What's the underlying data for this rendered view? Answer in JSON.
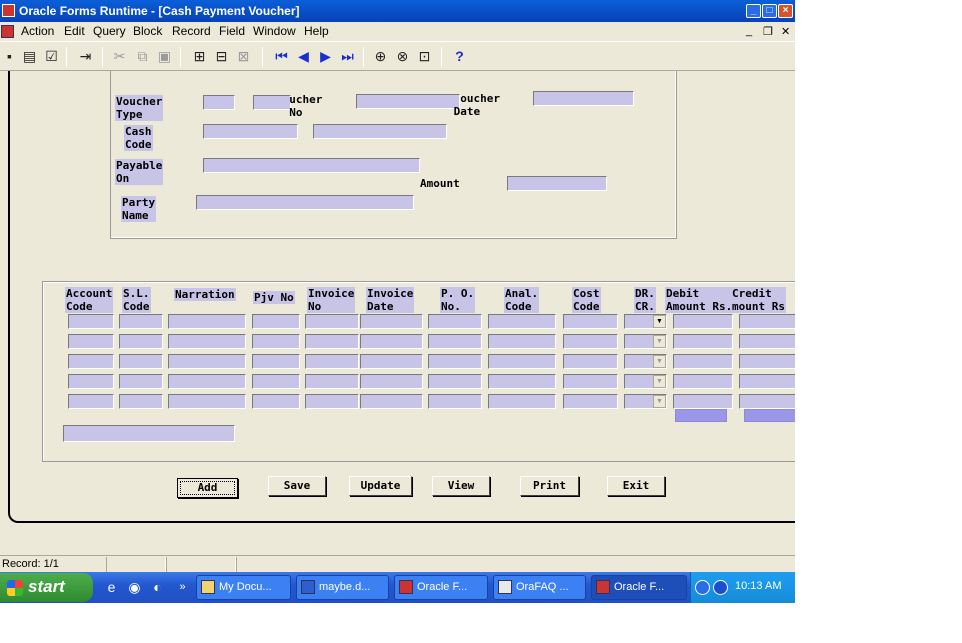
{
  "window": {
    "title": "Oracle Forms Runtime - [Cash Payment Voucher]"
  },
  "menu": [
    "Action",
    "Edit",
    "Query",
    "Block",
    "Record",
    "Field",
    "Window",
    "Help"
  ],
  "header_labels": {
    "voucher_type": "Voucher\nType",
    "voucher_no": "  ucher\n  No",
    "voucher_date": "  oucher\n Date",
    "cash_code": "Cash\nCode",
    "payable_on": "Payable\nOn",
    "amount": "Amount",
    "party_name": "Party\nName"
  },
  "columns": [
    "Account\nCode",
    "S.L.\nCode",
    "Narration",
    "Pjv No",
    "Invoice\nNo",
    "Invoice\nDate",
    "P. O.\nNo.",
    "Anal.\nCode",
    "Cost\nCode",
    "DR.\nCR.",
    "Debit\nAmount Rs.",
    "Credit\nmount Rs"
  ],
  "buttons": {
    "add": "Add",
    "save": "Save",
    "update": "Update",
    "view": "View",
    "print": "Print",
    "exit": "Exit"
  },
  "status": {
    "record": "Record: 1/1"
  },
  "taskbar": {
    "start": "start",
    "tasks": [
      "My Docu...",
      "maybe.d...",
      "Oracle F...",
      "OraFAQ ...",
      "Oracle F..."
    ],
    "clock": "10:13 AM"
  },
  "colors": {
    "field_fill": "#c7c4e8",
    "sum_fill": "#9a97e8",
    "form_bg": "#ece9d8",
    "titlebar": "#0842b8"
  }
}
